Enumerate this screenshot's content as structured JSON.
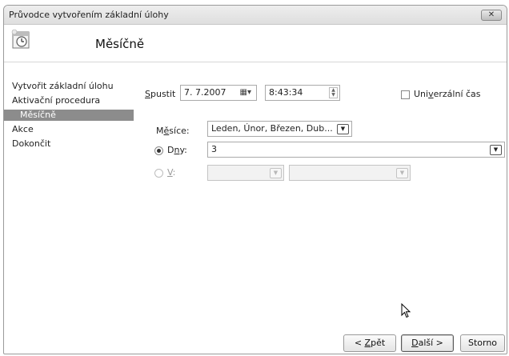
{
  "window": {
    "title": "Průvodce vytvořením základní úlohy",
    "close_label": "✕"
  },
  "header": {
    "title": "Měsíčně",
    "icon": "calendar-clock-icon"
  },
  "nav": {
    "items": [
      {
        "label": "Vytvořit základní úlohu"
      },
      {
        "label": "Aktivační procedura"
      },
      {
        "label": "Měsíčně"
      },
      {
        "label": "Akce"
      },
      {
        "label": "Dokončit"
      }
    ]
  },
  "start": {
    "label_prefix": "S",
    "label_rest": "pustit",
    "date": "7. 7.2007",
    "time": "8:43:34",
    "universal_label_pre": "Uni",
    "universal_label_u": "v",
    "universal_label_post": "erzální čas"
  },
  "months": {
    "label_pre": "M",
    "label_u": "ě",
    "label_post": "síce:",
    "value": "Leden, Únor, Březen, Dub..."
  },
  "days": {
    "label_pre": "D",
    "label_u": "n",
    "label_post": "y:",
    "value": "3"
  },
  "on": {
    "label_u": "V",
    "label_post": ":"
  },
  "buttons": {
    "back_pre": "< ",
    "back_u": "Z",
    "back_post": "pět",
    "next_u": "D",
    "next_post": "alší >",
    "cancel": "Storno"
  }
}
